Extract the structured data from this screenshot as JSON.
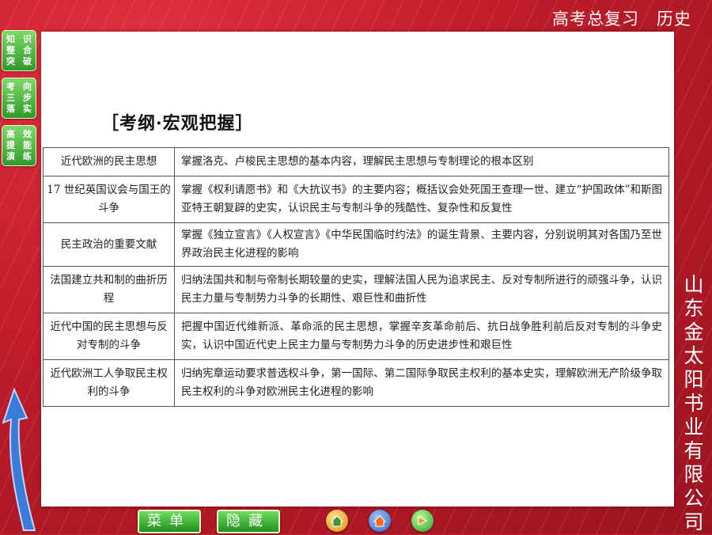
{
  "header": {
    "subject": "高考总复习",
    "course": "历史"
  },
  "side_tabs": [
    {
      "chars": [
        "知",
        "识",
        "整",
        "合",
        "突",
        "破"
      ]
    },
    {
      "chars": [
        "考",
        "向",
        "三",
        "步",
        "落",
        "实"
      ]
    },
    {
      "chars": [
        "高",
        "效",
        "提",
        "能",
        "演",
        "练"
      ]
    }
  ],
  "publisher": "山东金太阳书业有限公司",
  "section_title": "［考纲·宏观把握］",
  "table": {
    "rows": [
      {
        "topic": "近代欧洲的民主思想",
        "requirement": "掌握洛克、卢梭民主思想的基本内容，理解民主思想与专制理论的根本区别"
      },
      {
        "topic": "17 世纪英国议会与国王的斗争",
        "requirement": "掌握《权利请愿书》和《大抗议书》的主要内容；概括议会处死国王查理一世、建立“护国政体”和斯图亚特王朝复辟的史实，认识民主与专制斗争的残酷性、复杂性和反复性"
      },
      {
        "topic": "民主政治的重要文献",
        "requirement": "掌握《独立宣言》《人权宣言》《中华民国临时约法》的诞生背景、主要内容，分别说明其对各国乃至世界政治民主化进程的影响"
      },
      {
        "topic": "法国建立共和制的曲折历程",
        "requirement": "归纳法国共和制与帝制长期较量的史实，理解法国人民为追求民主、反对专制所进行的顽强斗争，认识民主力量与专制势力斗争的长期性、艰巨性和曲折性"
      },
      {
        "topic": "近代中国的民主思想与反对专制的斗争",
        "requirement": "把握中国近代维新派、革命派的民主思想，掌握辛亥革命前后、抗日战争胜利前后反对专制的斗争史实，认识中国近代史上民主力量与专制势力斗争的历史进步性和艰巨性"
      },
      {
        "topic": "近代欧洲工人争取民主权利的斗争",
        "requirement": "归纳宪章运动要求普选权斗争，第一国际、第二国际争取民主权利的基本史实，理解欧洲无产阶级争取民主权利的斗争对欧洲民主化进程的影响"
      }
    ]
  },
  "bottom_menu": {
    "menu_label": "菜单",
    "hide_label": "隐藏"
  },
  "nav_icons": [
    "home-icon",
    "back-home-icon",
    "next-icon"
  ],
  "colors": {
    "background": "#c8202f",
    "tab_green": "#2f9a2a",
    "panel": "#ffffff"
  }
}
